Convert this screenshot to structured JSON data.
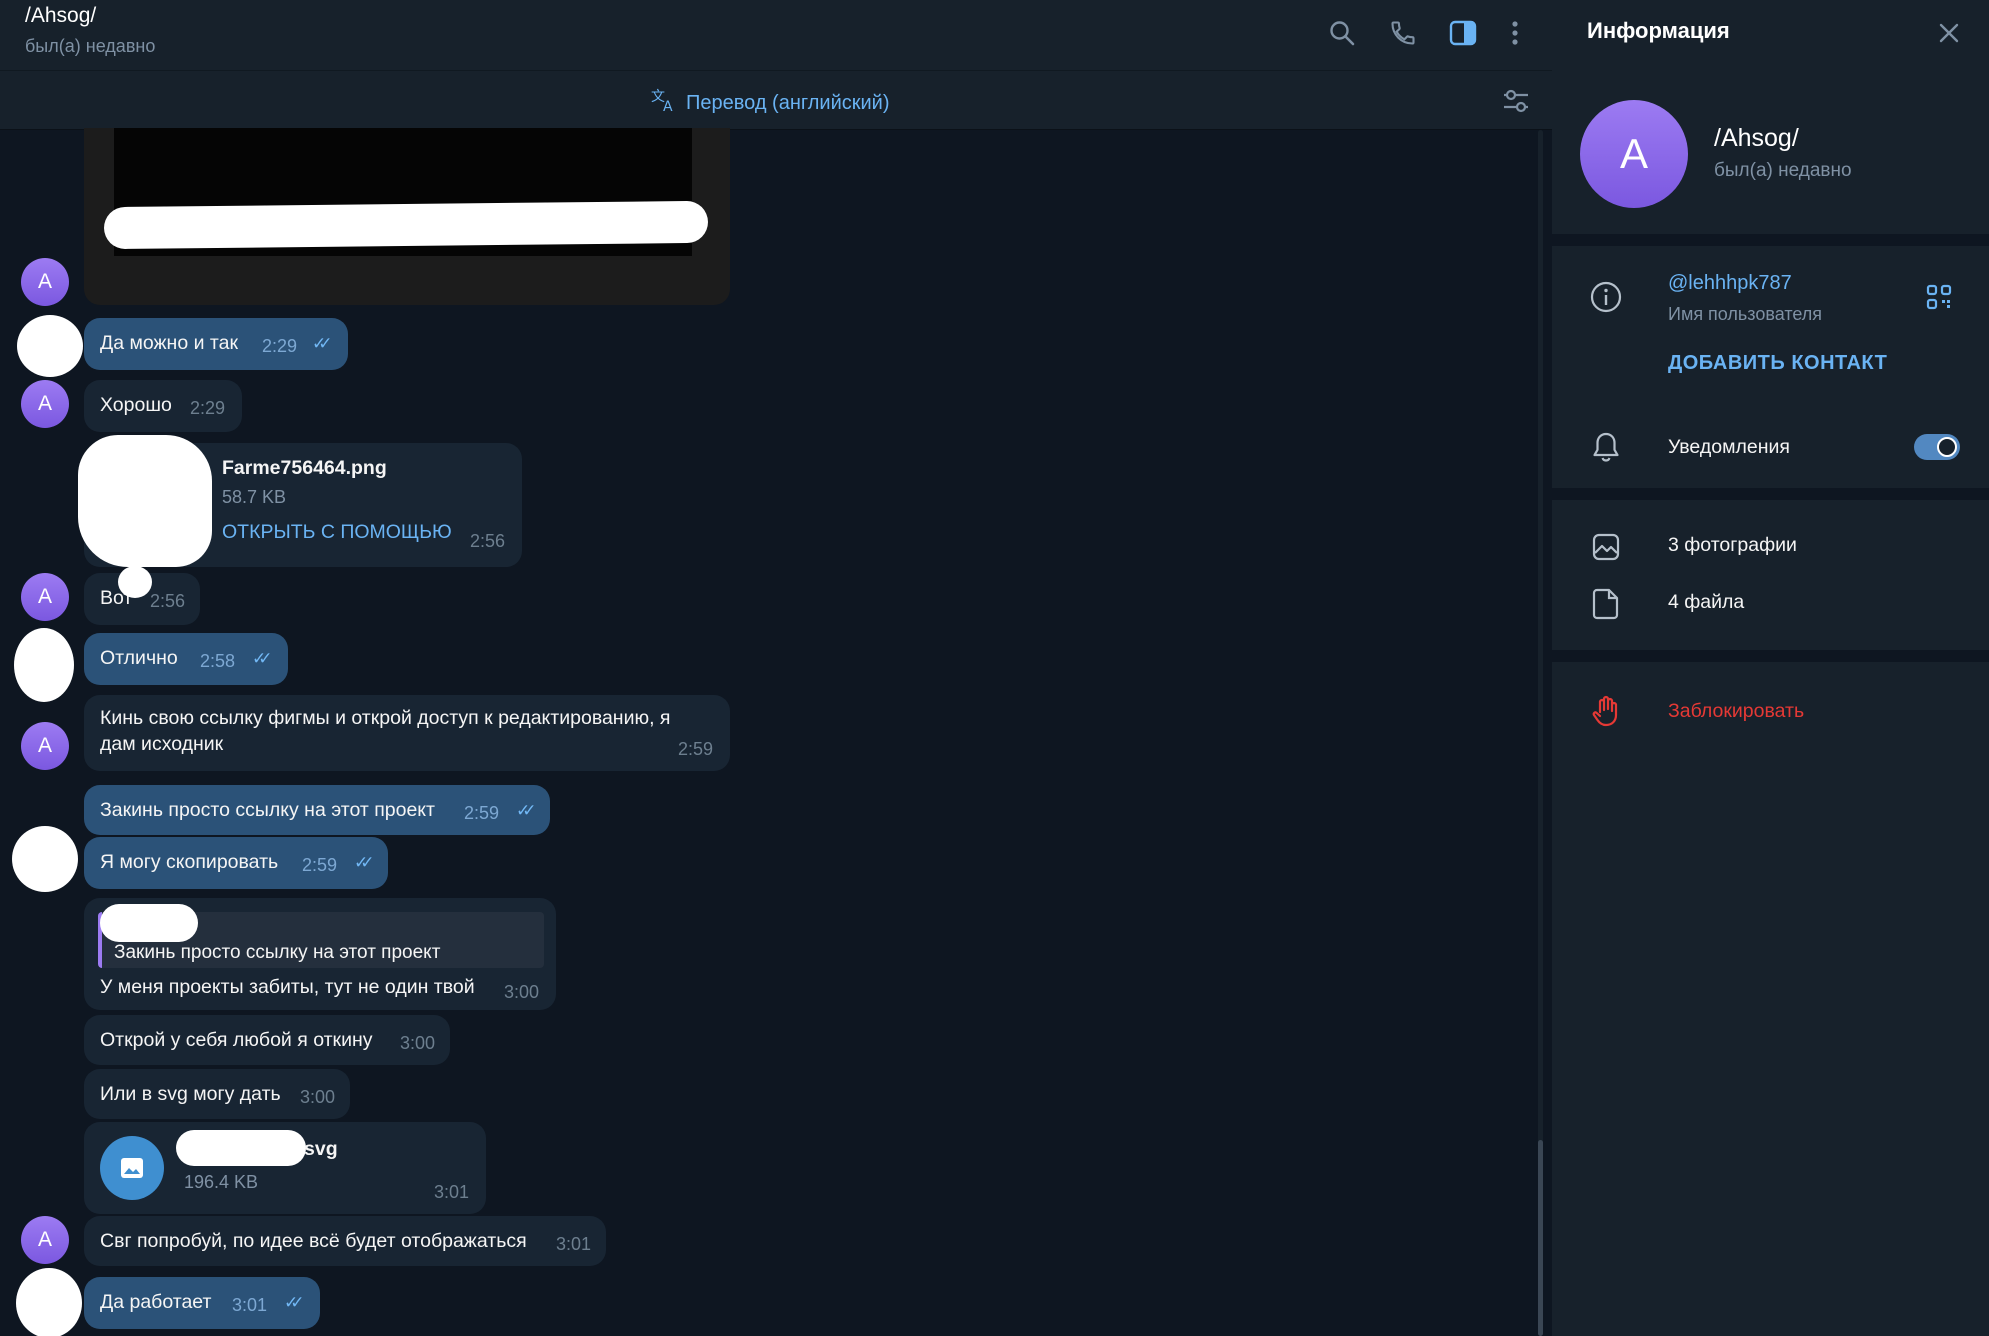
{
  "chat": {
    "title": "/Ahsog/",
    "status": "был(а) недавно",
    "translate_label": "Перевод (английский)",
    "icons": [
      "search-icon",
      "phone-icon",
      "sidebar-toggle-icon",
      "more-vert-icon",
      "translate-icon",
      "settings-sliders-icon"
    ]
  },
  "avatar_letter": "A",
  "messages": {
    "m1": {
      "text": "Да можно и так",
      "time": "2:29"
    },
    "m2": {
      "text": "Хорошо",
      "time": "2:29"
    },
    "file1": {
      "name": "Farme756464.png",
      "size": "58.7 KB",
      "action": "ОТКРЫТЬ С ПОМОЩЬЮ",
      "time": "2:56"
    },
    "m3": {
      "text": "Вот",
      "time": "2:56"
    },
    "m4": {
      "text": "Отлично",
      "time": "2:58"
    },
    "m5": {
      "line1": "Кинь свою ссылку фигмы и открой доступ к редактированию, я",
      "line2": "дам исходник",
      "time": "2:59"
    },
    "m6": {
      "text": "Закинь просто ссылку на этот проект",
      "time": "2:59"
    },
    "m7": {
      "text": "Я могу скопировать",
      "time": "2:59"
    },
    "m8": {
      "quote": "Закинь просто ссылку на этот проект",
      "text": "У меня проекты забиты, тут не один твой",
      "time": "3:00"
    },
    "m9": {
      "text": "Открой у себя любой я откину",
      "time": "3:00"
    },
    "m10": {
      "text": "Или в svg могу дать",
      "time": "3:00"
    },
    "file2": {
      "name_suffix": "svg",
      "size": "196.4 KB",
      "time": "3:01"
    },
    "m11": {
      "text": "Свг попробуй, по идее всё будет отображаться",
      "time": "3:01"
    },
    "m12": {
      "text": "Да работает",
      "time": "3:01"
    }
  },
  "panel": {
    "title": "Информация",
    "name": "/Ahsog/",
    "status": "был(а) недавно",
    "username": "@lehhhpk787",
    "username_label": "Имя пользователя",
    "add_contact": "ДОБАВИТЬ КОНТАКТ",
    "notifications": "Уведомления",
    "notifications_on": true,
    "photos": "3 фотографии",
    "files": "4 файла",
    "block": "Заблокировать"
  },
  "colors": {
    "background": "#0e1621",
    "header": "#17212b",
    "incoming_bubble": "#182533",
    "outgoing_bubble": "#2b5278",
    "accent": "#6ab3f3",
    "danger": "#e53935"
  }
}
